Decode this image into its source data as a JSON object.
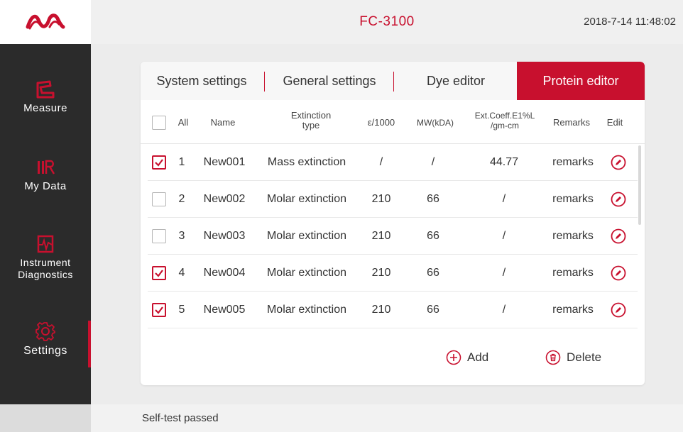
{
  "app": {
    "title": "FC-3100",
    "datetime": "2018-7-14  11:48:02"
  },
  "colors": {
    "accent": "#c8102e",
    "sidebar": "#2b2b2b"
  },
  "sidebar": {
    "items": [
      {
        "label": "Measure",
        "icon": "measure-icon"
      },
      {
        "label": "My Data",
        "icon": "my-data-icon"
      },
      {
        "label": "Instrument",
        "label2": "Diagnostics",
        "icon": "diagnostics-icon"
      },
      {
        "label": "Settings",
        "icon": "gear-icon",
        "active": true
      }
    ]
  },
  "tabs": [
    {
      "label": "System settings",
      "active": false
    },
    {
      "label": "General settings",
      "active": false
    },
    {
      "label": "Dye editor",
      "active": false
    },
    {
      "label": "Protein editor",
      "active": true
    }
  ],
  "table": {
    "headers": {
      "all": "All",
      "name": "Name",
      "ext_type_1": "Extinction",
      "ext_type_2": "type",
      "eps": "ε/1000",
      "mw": "MW(kDA)",
      "coeff_1": "Ext.Coeff.E1%L",
      "coeff_2": "/gm-cm",
      "remarks": "Remarks",
      "edit": "Edit"
    },
    "rows": [
      {
        "checked": true,
        "index": "1",
        "name": "New001",
        "type": "Mass extinction",
        "eps": "/",
        "mw": "/",
        "coeff": "44.77",
        "remarks": "remarks"
      },
      {
        "checked": false,
        "index": "2",
        "name": "New002",
        "type": "Molar extinction",
        "eps": "210",
        "mw": "66",
        "coeff": "/",
        "remarks": "remarks"
      },
      {
        "checked": false,
        "index": "3",
        "name": "New003",
        "type": "Molar extinction",
        "eps": "210",
        "mw": "66",
        "coeff": "/",
        "remarks": "remarks"
      },
      {
        "checked": true,
        "index": "4",
        "name": "New004",
        "type": "Molar extinction",
        "eps": "210",
        "mw": "66",
        "coeff": "/",
        "remarks": "remarks"
      },
      {
        "checked": true,
        "index": "5",
        "name": "New005",
        "type": "Molar extinction",
        "eps": "210",
        "mw": "66",
        "coeff": "/",
        "remarks": "remarks"
      }
    ]
  },
  "actions": {
    "add": "Add",
    "delete": "Delete"
  },
  "status": {
    "text": "Self-test passed"
  }
}
